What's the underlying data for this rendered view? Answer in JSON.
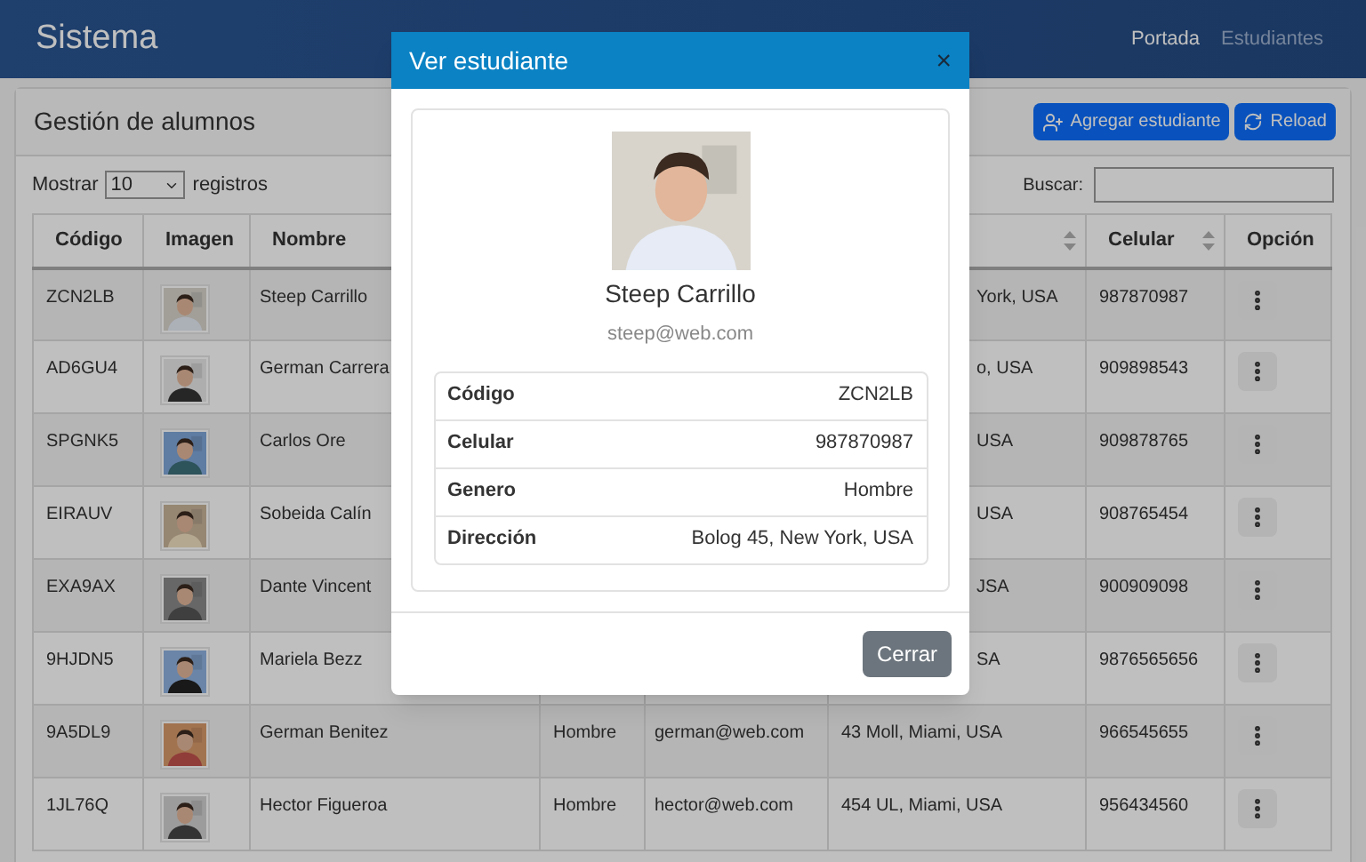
{
  "navbar": {
    "brand": "Sistema",
    "links": [
      {
        "label": "Portada",
        "selected": true
      },
      {
        "label": "Estudiantes",
        "selected": false
      }
    ]
  },
  "card": {
    "title": "Gestión de alumnos",
    "buttons": [
      {
        "label": "Agregar estudiante",
        "kind": "add"
      },
      {
        "label": "Reload",
        "kind": "reload"
      }
    ]
  },
  "length_control": {
    "before": "Mostrar",
    "value": "10",
    "after": "registros"
  },
  "search": {
    "label": "Buscar:"
  },
  "table": {
    "columns": [
      {
        "label": "Código",
        "sortable": false
      },
      {
        "label": "Imagen",
        "sortable": false
      },
      {
        "label": "Nombre"
      },
      {},
      {},
      {
        "sortable": true
      },
      {
        "label": "Celular",
        "sortable": true
      },
      {
        "label": "Opción",
        "sortable": false
      }
    ],
    "rows": [
      {
        "code": "ZCN2LB",
        "name": "Steep Carrillo",
        "address": "York, USA",
        "cut": true,
        "phone": "987870987"
      },
      {
        "code": "AD6GU4",
        "name": "German Carrera",
        "address": "o, USA",
        "cut": true,
        "phone": "909898543"
      },
      {
        "code": "SPGNK5",
        "name": "Carlos Ore",
        "address": "USA",
        "cut": true,
        "phone": "909878765"
      },
      {
        "code": "EIRAUV",
        "name": "Sobeida Calín",
        "address": "USA",
        "cut": true,
        "phone": "908765454"
      },
      {
        "code": "EXA9AX",
        "name": "Dante Vincent",
        "address": "JSA",
        "cut": true,
        "phone": "900909098"
      },
      {
        "code": "9HJDN5",
        "name": "Mariela Bezz",
        "address": "SA",
        "cut": true,
        "phone": "9876565656"
      },
      {
        "code": "9A5DL9",
        "name": "German Benitez",
        "gender": "Hombre",
        "email": "german@web.com",
        "address": "43 Moll, Miami, USA",
        "cut": false,
        "phone": "966545655"
      },
      {
        "code": "1JL76Q",
        "name": "Hector Figueroa",
        "gender": "Hombre",
        "email": "hector@web.com",
        "address": "454 UL, Miami, USA",
        "cut": false,
        "phone": "956434560"
      }
    ]
  },
  "modal": {
    "title": "Ver estudiante",
    "close": "×",
    "name": "Steep Carrillo",
    "email": "steep@web.com",
    "details": [
      {
        "label": "Código",
        "value": "ZCN2LB"
      },
      {
        "label": "Celular",
        "value": "987870987"
      },
      {
        "label": "Genero",
        "value": "Hombre"
      },
      {
        "label": "Dirección",
        "value": "Bolog 45, New York, USA"
      }
    ],
    "footer_button": "Cerrar"
  }
}
